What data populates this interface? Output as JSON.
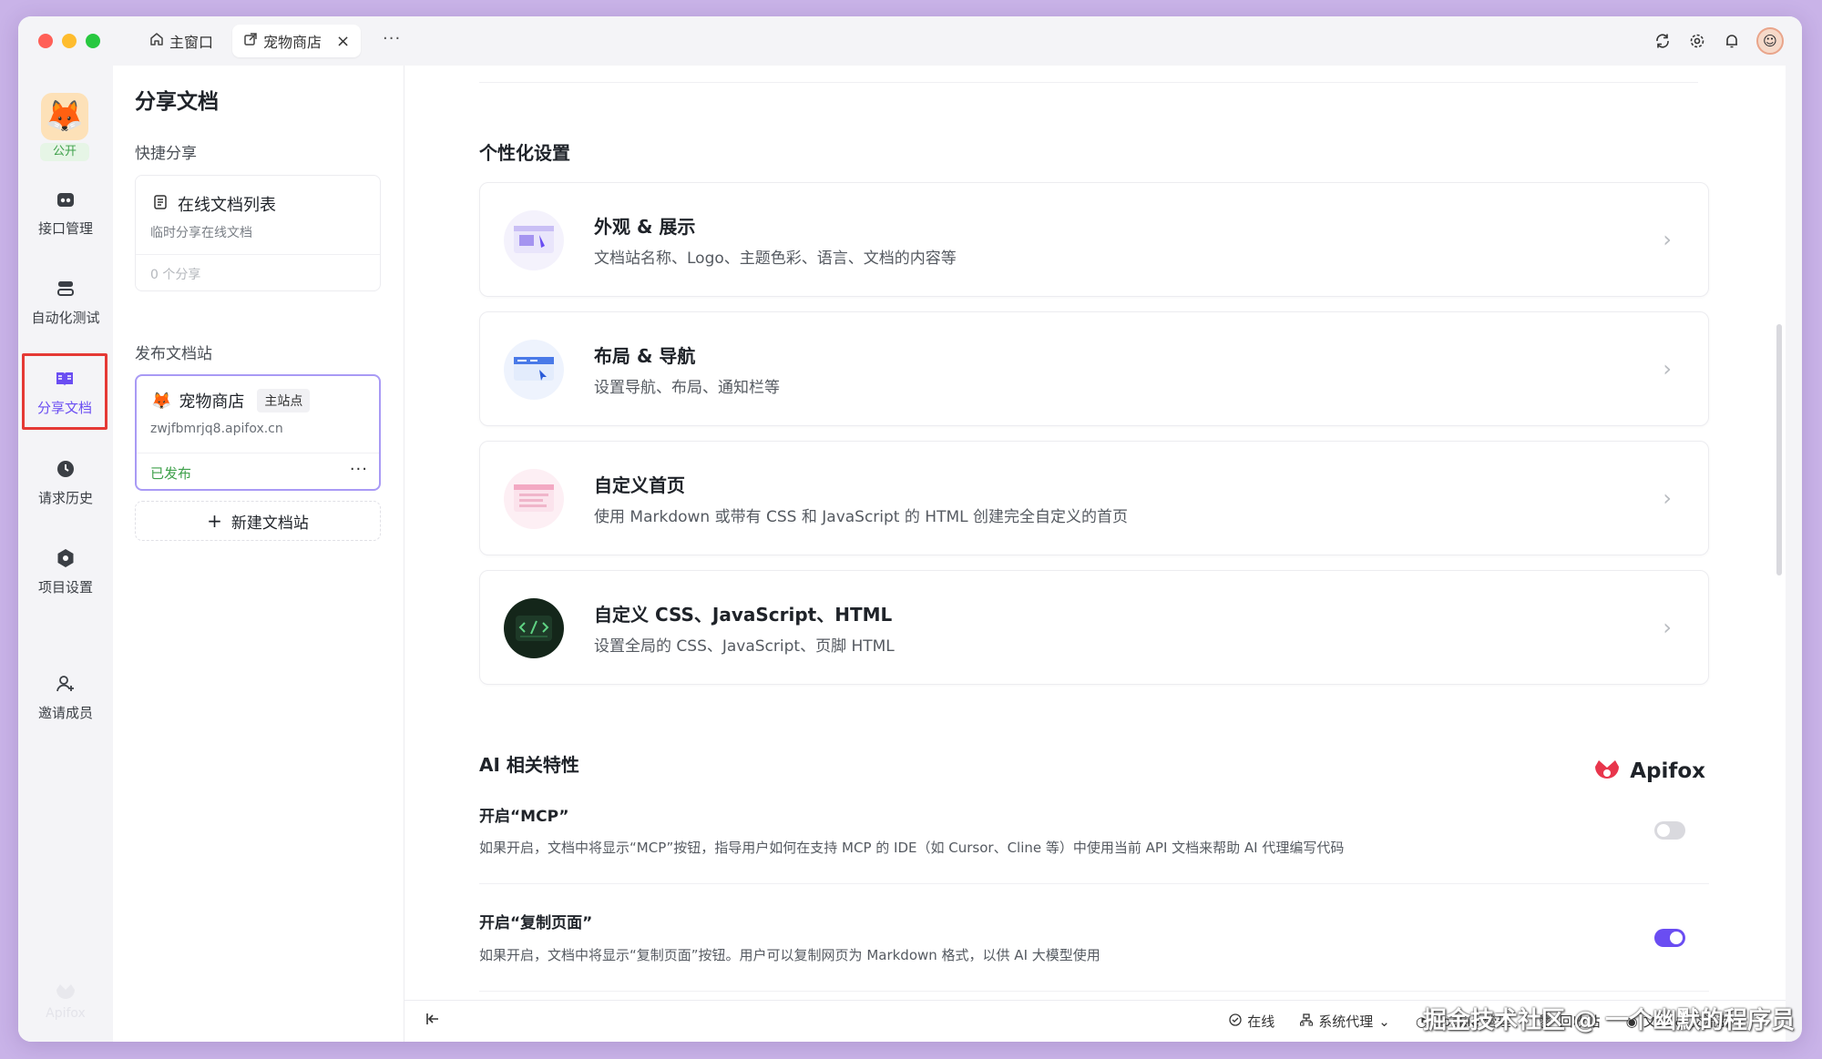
{
  "titlebar": {
    "tabs": [
      {
        "label": "主窗口",
        "icon": "home-icon"
      },
      {
        "label": "宠物商店",
        "icon": "share-icon",
        "active": true
      }
    ]
  },
  "leftnav": {
    "project_badge": "公开",
    "items": [
      {
        "label": "接口管理",
        "icon": "api-icon"
      },
      {
        "label": "自动化测试",
        "icon": "automation-icon"
      },
      {
        "label": "分享文档",
        "icon": "book-icon",
        "active": true
      },
      {
        "label": "请求历史",
        "icon": "clock-icon"
      },
      {
        "label": "项目设置",
        "icon": "settings-icon"
      },
      {
        "label": "邀请成员",
        "icon": "add-user-icon"
      }
    ],
    "footer_logo": "Apifox"
  },
  "panel": {
    "title": "分享文档",
    "quick_share_label": "快捷分享",
    "online_docs": {
      "title": "在线文档列表",
      "subtitle": "临时分享在线文档",
      "count": "0 个分享"
    },
    "publish_label": "发布文档站",
    "site": {
      "name": "宠物商店",
      "badge": "主站点",
      "url": "zwjfbmrjq8.apifox.cn",
      "status": "已发布"
    },
    "new_site": "新建文档站"
  },
  "main": {
    "personal_section": "个性化设置",
    "cards": [
      {
        "title": "外观 & 展示",
        "desc": "文档站名称、Logo、主题色彩、语言、文档的内容等"
      },
      {
        "title": "布局 & 导航",
        "desc": "设置导航、布局、通知栏等"
      },
      {
        "title": "自定义首页",
        "desc": "使用 Markdown 或带有 CSS 和 JavaScript 的 HTML 创建完全自定义的首页"
      },
      {
        "title": "自定义 CSS、JavaScript、HTML",
        "desc": "设置全局的 CSS、JavaScript、页脚 HTML"
      }
    ],
    "ai_section": "AI 相关特性",
    "ai_logo": "Apifox",
    "options": [
      {
        "title": "开启“MCP”",
        "desc": "如果开启，文档中将显示“MCP”按钮，指导用户如何在支持 MCP 的 IDE（如 Cursor、Cline 等）中使用当前 API 文档来帮助 AI 代理编写代码",
        "enabled": false
      },
      {
        "title": "开启“复制页面”",
        "desc": "如果开启，文档中将显示“复制页面”按钮。用户可以复制网页为 Markdown 格式，以供 AI 大模型使用",
        "enabled": true
      }
    ]
  },
  "footer": {
    "online": "在线",
    "proxy": "系统代理",
    "cookie": "Cookie 管理",
    "recycle": "回收站",
    "community": "文档 & 交流群"
  },
  "watermark": "掘金技术社区 @ 一个幽默的程序员",
  "colors": {
    "accent": "#6a4df2",
    "success": "#3ea04a",
    "highlight_border": "#e53935"
  }
}
